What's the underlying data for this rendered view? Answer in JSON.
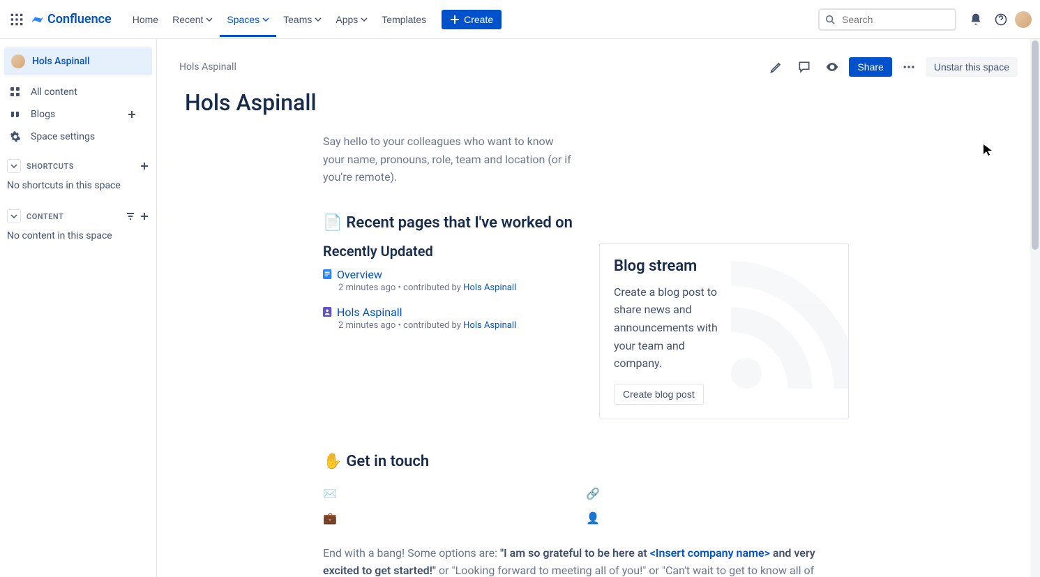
{
  "brand": "Confluence",
  "nav": {
    "home": "Home",
    "recent": "Recent",
    "spaces": "Spaces",
    "teams": "Teams",
    "apps": "Apps",
    "templates": "Templates",
    "create": "Create"
  },
  "search": {
    "placeholder": "Search"
  },
  "sidebar": {
    "space_name": "Hols Aspinall",
    "all_content": "All content",
    "blogs": "Blogs",
    "space_settings": "Space settings",
    "shortcuts_label": "SHORTCUTS",
    "shortcuts_empty": "No shortcuts in this space",
    "content_label": "CONTENT",
    "content_empty": "No content in this space"
  },
  "page": {
    "breadcrumb": "Hols Aspinall",
    "share": "Share",
    "unstar": "Unstar this space",
    "title": "Hols Aspinall",
    "intro": "Say hello to your colleagues who want to know your name, pronouns, role, team and location (or if you're remote).",
    "recent_heading": "Recent pages that I've worked on",
    "recently_updated": "Recently Updated",
    "recent_items": [
      {
        "title": "Overview",
        "time": "2 minutes ago",
        "contributed_by_label": "contributed by",
        "author": "Hols Aspinall"
      },
      {
        "title": "Hols Aspinall",
        "time": "2 minutes ago",
        "contributed_by_label": "contributed by",
        "author": "Hols Aspinall"
      }
    ],
    "blog": {
      "title": "Blog stream",
      "text": "Create a blog post to share news and announcements with your team and company.",
      "button": "Create blog post"
    },
    "get_in_touch_heading": "Get in touch",
    "contact_icons": {
      "email": "✉️",
      "link": "🔗",
      "briefcase": "💼",
      "person": "👤"
    },
    "closing_prefix": "End with a bang! Some options are: ",
    "closing_bold1": "\"I am so grateful to be here at ",
    "closing_link": "<Insert company name>",
    "closing_bold2": " and very excited to get started!\"",
    "closing_rest": " or \"Looking forward to meeting all of you!\" or \"Can't wait to get to know all of"
  },
  "colors": {
    "primary": "#0052CC"
  }
}
